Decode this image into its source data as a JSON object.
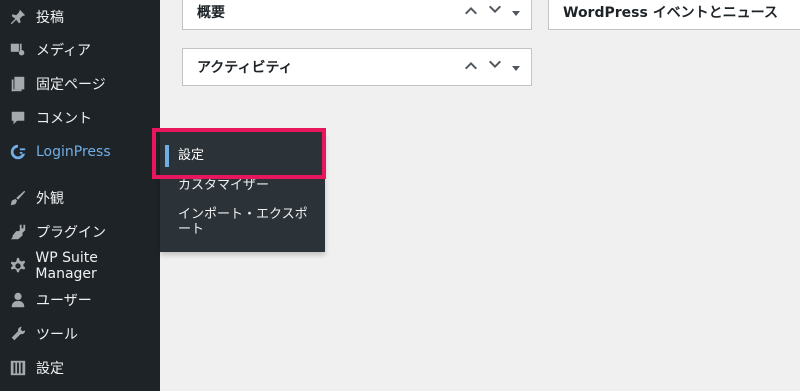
{
  "sidebar": {
    "items": [
      {
        "label": "投稿",
        "icon": "pushpin-icon"
      },
      {
        "label": "メディア",
        "icon": "media-icon"
      },
      {
        "label": "固定ページ",
        "icon": "page-icon"
      },
      {
        "label": "コメント",
        "icon": "comment-icon"
      },
      {
        "label": "LoginPress",
        "icon": "loginpress-icon"
      },
      {
        "label": "外観",
        "icon": "brush-icon"
      },
      {
        "label": "プラグイン",
        "icon": "plugin-icon"
      },
      {
        "label": "WP Suite Manager",
        "icon": "gear-icon"
      },
      {
        "label": "ユーザー",
        "icon": "user-icon"
      },
      {
        "label": "ツール",
        "icon": "wrench-icon"
      },
      {
        "label": "設定",
        "icon": "settings-icon"
      }
    ]
  },
  "flyout": {
    "items": [
      {
        "label": "設定"
      },
      {
        "label": "カスタマイザー"
      },
      {
        "label": "インポート・エクスポ"
      },
      {
        "label": "ート"
      }
    ]
  },
  "widgets": {
    "overview": {
      "title": "概要"
    },
    "activity": {
      "title": "アクティビティ"
    },
    "news": {
      "title": "WordPress イベントとニュース"
    }
  },
  "colors": {
    "sidebar_bg": "#1d2327",
    "flyout_bg": "#2c3338",
    "accent": "#72aee6",
    "highlight": "#e8175d"
  }
}
